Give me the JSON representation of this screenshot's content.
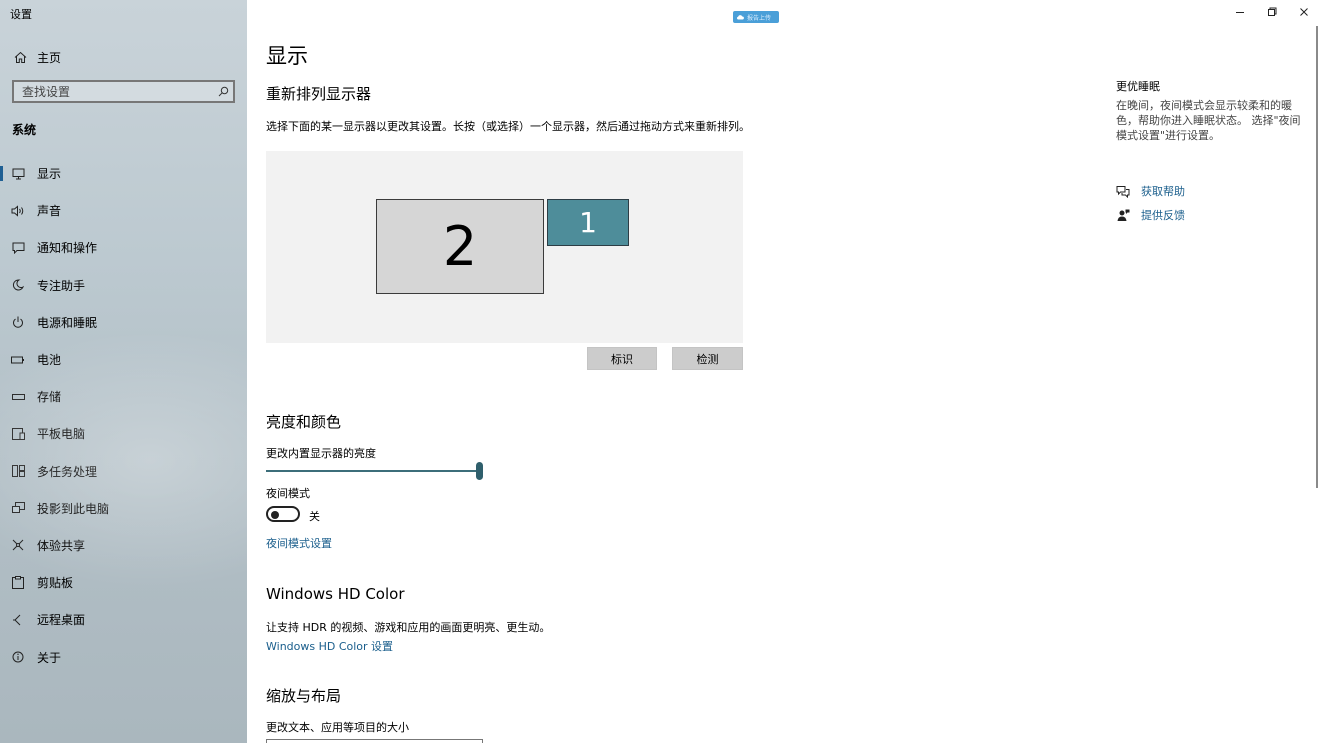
{
  "window": {
    "app_title": "设置"
  },
  "sidebar": {
    "home_label": "主页",
    "search_placeholder": "查找设置",
    "section_label": "系统",
    "items": [
      {
        "label": "显示",
        "icon": "monitor-icon",
        "active": true
      },
      {
        "label": "声音",
        "icon": "speaker-icon"
      },
      {
        "label": "通知和操作",
        "icon": "message-icon"
      },
      {
        "label": "专注助手",
        "icon": "moon-icon"
      },
      {
        "label": "电源和睡眠",
        "icon": "power-icon"
      },
      {
        "label": "电池",
        "icon": "battery-icon"
      },
      {
        "label": "存储",
        "icon": "storage-icon"
      },
      {
        "label": "平板电脑",
        "icon": "tablet-icon"
      },
      {
        "label": "多任务处理",
        "icon": "multitask-icon"
      },
      {
        "label": "投影到此电脑",
        "icon": "project-icon"
      },
      {
        "label": "体验共享",
        "icon": "share-icon"
      },
      {
        "label": "剪贴板",
        "icon": "clipboard-icon"
      },
      {
        "label": "远程桌面",
        "icon": "remote-icon"
      },
      {
        "label": "关于",
        "icon": "info-icon"
      }
    ]
  },
  "top_badge": {
    "text": "报告上传"
  },
  "main": {
    "page_title": "显示",
    "rearrange": {
      "heading": "重新排列显示器",
      "description": "选择下面的某一显示器以更改其设置。长按（或选择）一个显示器，然后通过拖动方式来重新排列。",
      "monitor_2": "2",
      "monitor_1": "1",
      "identify_button": "标识",
      "detect_button": "检测"
    },
    "brightness": {
      "heading": "亮度和颜色",
      "slider_label": "更改内置显示器的亮度",
      "slider_value_fraction": 0.98,
      "night_mode_label": "夜间模式",
      "night_mode_state": "关",
      "night_mode_link": "夜间模式设置"
    },
    "hdr": {
      "heading": "Windows HD Color",
      "description": "让支持 HDR 的视频、游戏和应用的画面更明亮、更生动。",
      "link": "Windows HD Color 设置"
    },
    "scale": {
      "heading": "缩放与布局",
      "label": "更改文本、应用等项目的大小"
    }
  },
  "right_column": {
    "title": "更优睡眠",
    "body": "在晚间，夜间模式会显示较柔和的暖色，帮助你进入睡眠状态。 选择\"夜间模式设置\"进行设置。",
    "help_link": "获取帮助",
    "feedback_link": "提供反馈"
  },
  "colors": {
    "accent_link": "#1a5e8c",
    "monitor_selected": "#4e8d9a",
    "sidebar_bg": "#bcc9d0"
  }
}
